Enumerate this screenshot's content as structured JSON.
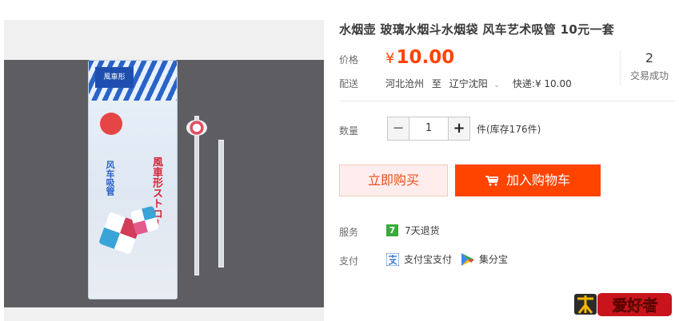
{
  "product": {
    "title": "水烟壶 玻璃水烟斗水烟袋 风车艺术吸管 10元一套"
  },
  "image": {
    "package_label": "風車形",
    "package_text_left": "风车吸管",
    "package_text_right": "風車形ストロー"
  },
  "price": {
    "label": "价格",
    "currency": "¥",
    "value": "10.00"
  },
  "sales": {
    "count": "2",
    "label": "交易成功"
  },
  "shipping": {
    "label": "配送",
    "from": "河北沧州",
    "to_word": "至",
    "to": "辽宁沈阳",
    "method": "快递:¥ 10.00"
  },
  "quantity": {
    "label": "数量",
    "value": "1",
    "minus": "−",
    "plus": "+",
    "stock": "件(库存176件)"
  },
  "actions": {
    "buy_now": "立即购买",
    "add_cart": "加入购物车"
  },
  "service": {
    "label": "服务",
    "badge": "7",
    "text": "7天退货"
  },
  "payment": {
    "label": "支付",
    "methods": [
      "支付宝支付",
      "集分宝"
    ]
  },
  "watermark": {
    "text": "爱好者"
  },
  "colors": {
    "accent": "#ff4400",
    "price": "#ff4400",
    "service_badge": "#3ba93c"
  },
  "icons": [
    "cart-icon",
    "alipay-icon",
    "jifenbao-icon",
    "chevron-down-icon"
  ]
}
